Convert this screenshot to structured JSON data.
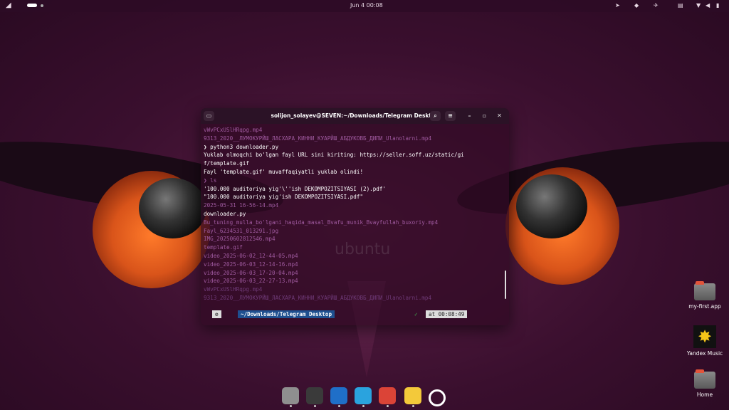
{
  "topbar": {
    "date_time": "Jun 4  00:08"
  },
  "terminal": {
    "title": "solijon_solayev@SEVEN:~/Downloads/Telegram Desktop",
    "lines": [
      {
        "text": "vWvPCxUSlHRqpg.mp4",
        "style": "dim"
      },
      {
        "text": "9313_2020__ЛУМОКУРЙШ_ЛАСХАРА_КИННИ_КУАРЙШ_АБДУКОВБ_ДИПИ_Ulanolarni.mp4",
        "style": "dim"
      },
      {
        "text": "❯ python3 downloader.py",
        "style": "cmd"
      },
      {
        "text": "Yuklab olmoqchi bo'lgan fayl URL sini kiriting: https://seller.soff.uz/static/gi",
        "style": "normal"
      },
      {
        "text": "f/template.gif",
        "style": "normal"
      },
      {
        "text": "Fayl 'template.gif' muvaffaqiyatli yuklab olindi!",
        "style": "normal"
      },
      {
        "text": "❯ ls",
        "style": "dim"
      },
      {
        "text": "'100.000 auditoriya yig'\\''ish DEKOMPOZITSIYASI (2).pdf'",
        "style": "normal"
      },
      {
        "text": "\"100.000 auditoriya yig'ish DEKOMPOZITSIYASI.pdf\"",
        "style": "normal"
      },
      {
        "text": "2025-05-31 16-56-14.mp4",
        "style": "dim"
      },
      {
        "text": "downloader.py",
        "style": "normal"
      },
      {
        "text": "Bu_tuning_mulla_bo'lgani_haqida_masal_Bvafu_munik_Bvayfullah_buxoriy.mp4",
        "style": "dim"
      },
      {
        "text": "Fayl_6234531_013291.jpg",
        "style": "dim"
      },
      {
        "text": "IMG_20250602812546.mp4",
        "style": "dim"
      },
      {
        "text": "template.gif",
        "style": "dim"
      },
      {
        "text": "video_2025-06-02_12-44-05.mp4",
        "style": "dim"
      },
      {
        "text": "video_2025-06-03_12-14-16.mp4",
        "style": "dim"
      },
      {
        "text": "video_2025-06-03_17-20-04.mp4",
        "style": "dim"
      },
      {
        "text": "video_2025-06-03_22-27-13.mp4",
        "style": "dim"
      },
      {
        "text": "vWvPCxUSlHRqpg.mp4",
        "style": "fade"
      },
      {
        "text": "9313_2020__ЛУМОКУРЙШ_ЛАСХАРА_КИННИ_КУАРЙШ_АБДУКОВБ_ДИПИ_Ulanolarni.mp4",
        "style": "fade"
      }
    ],
    "prompt": {
      "path": "~/Downloads/Telegram Desktop",
      "check": "✓",
      "time": "at 00:08:49"
    }
  },
  "watermark": "ubuntu",
  "desktop": {
    "icons": [
      {
        "label": "my-first.app"
      },
      {
        "label": "Yandex Music"
      },
      {
        "label": "Home"
      }
    ]
  },
  "dock": {
    "items": [
      {
        "name": "files",
        "color": "#8f8f8f"
      },
      {
        "name": "terminal",
        "color": "#3a3a3a"
      },
      {
        "name": "vscode",
        "color": "#1f6fc9"
      },
      {
        "name": "telegram",
        "color": "#2aa3de"
      },
      {
        "name": "chrome",
        "color": "#db4437"
      },
      {
        "name": "text-editor",
        "color": "#f3c93a"
      },
      {
        "name": "app-grid",
        "color": "#ffffff"
      }
    ]
  }
}
